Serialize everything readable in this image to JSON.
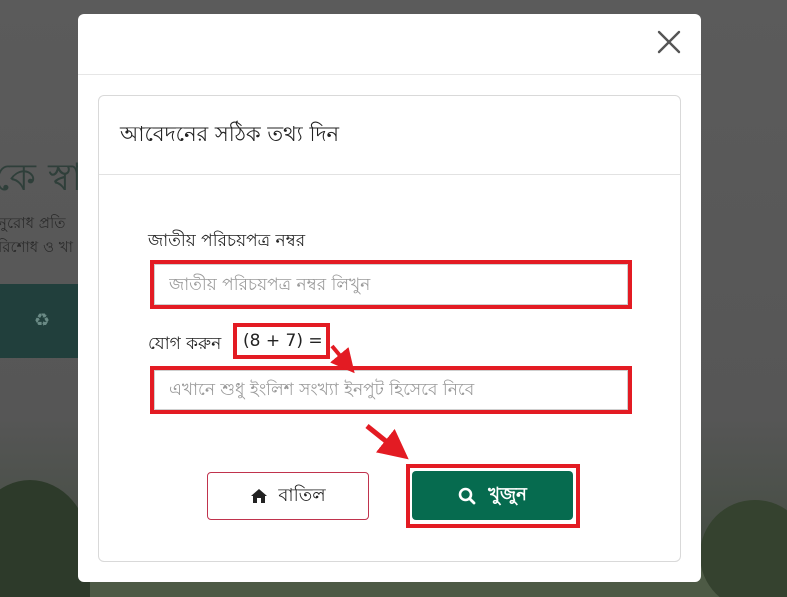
{
  "background": {
    "heading": "কে স্বা",
    "line1": "নুরোধ প্রতি",
    "line2": "রিশোধ ও খা"
  },
  "modal": {
    "card_title": "আবেদনের সঠিক তথ্য দিন",
    "nid": {
      "label": "জাতীয় পরিচয়পত্র নম্বর",
      "placeholder": "জাতীয় পরিচয়পত্র নম্বর লিখুন",
      "value": ""
    },
    "captcha": {
      "label": "যোগ করুন",
      "equation": "(8 + 7) =",
      "placeholder": "এখানে শুধু ইংলিশ সংখ্যা ইনপুট হিসেবে নিবে",
      "value": ""
    },
    "cancel_label": "বাতিল",
    "search_label": "খুজুন"
  },
  "colors": {
    "primary_green": "#066b4f",
    "highlight_red": "#e31b23",
    "cancel_border": "#c0334d"
  },
  "icons": {
    "close": "close-icon",
    "home": "home-icon",
    "search": "search-icon"
  }
}
